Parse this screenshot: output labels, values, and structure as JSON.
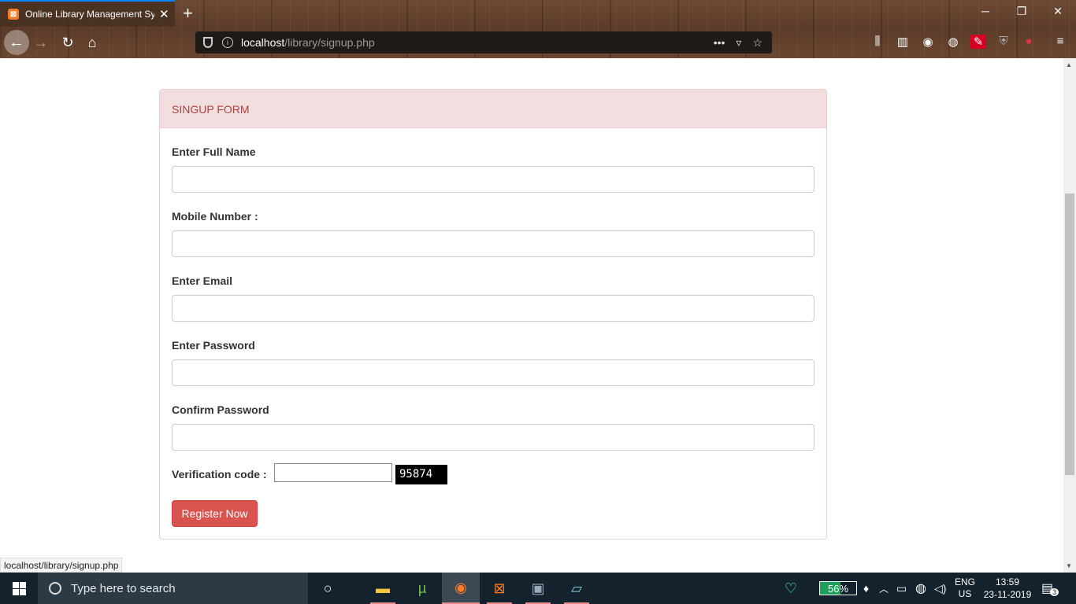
{
  "browser": {
    "tab_title": "Online Library Management Sy",
    "tab_favicon": "xampp-icon",
    "url_host": "localhost",
    "url_path": "/library/signup.php",
    "page_actions": [
      "•••"
    ]
  },
  "form": {
    "heading": "SINGUP FORM",
    "fields": [
      {
        "label": "Enter Full Name",
        "value": ""
      },
      {
        "label": "Mobile Number :",
        "value": ""
      },
      {
        "label": "Enter Email",
        "value": ""
      },
      {
        "label": "Enter Password",
        "value": ""
      },
      {
        "label": "Confirm Password",
        "value": ""
      }
    ],
    "verification_label": "Verification code :",
    "verification_value": "",
    "captcha": "95874",
    "submit_label": "Register Now"
  },
  "status_bar": "localhost/library/signup.php",
  "taskbar": {
    "search_placeholder": "Type here to search",
    "battery_percent": 56,
    "battery_text": "56%",
    "lang_top": "ENG",
    "lang_bottom": "US",
    "time": "13:59",
    "date": "23-11-2019",
    "notifications": "3"
  },
  "colors": {
    "panel_heading_bg": "#f2dede",
    "panel_heading_text": "#a94442",
    "panel_border": "#ebccd1",
    "button_bg": "#d9534f",
    "taskbar_bg": "#13222d"
  }
}
